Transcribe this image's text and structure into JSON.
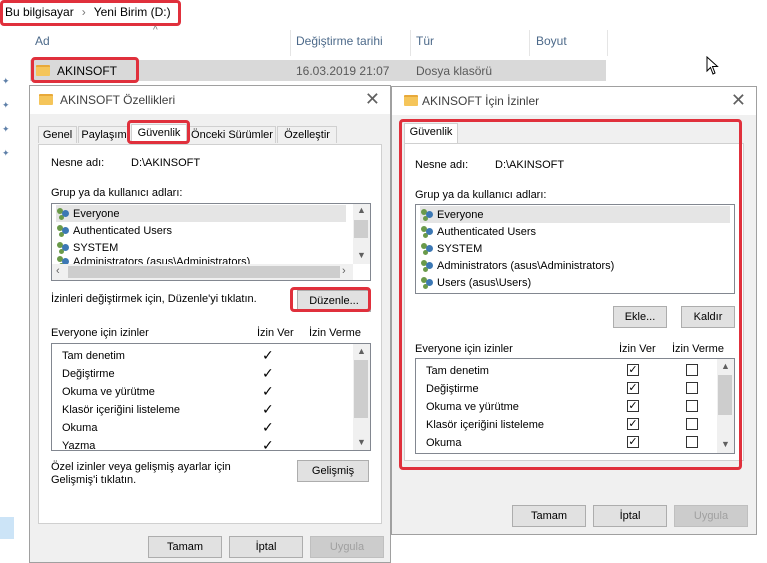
{
  "explorer": {
    "breadcrumb": [
      "Bu bilgisayar",
      "Yeni Birim (D:)"
    ],
    "breadcrumb_separator": "›",
    "columns": [
      "Ad",
      "Değiştirme tarihi",
      "Tür",
      "Boyut"
    ],
    "file": {
      "name": "AKINSOFT",
      "modified": "16.03.2019 21:07",
      "type": "Dosya klasörü"
    }
  },
  "props_dialog": {
    "title": "AKINSOFT Özellikleri",
    "tabs": [
      "Genel",
      "Paylaşım",
      "Güvenlik",
      "Önceki Sürümler",
      "Özelleştir"
    ],
    "active_tab": "Güvenlik",
    "object_label": "Nesne adı:",
    "object_value": "D:\\AKINSOFT",
    "group_label": "Grup ya da kullanıcı adları:",
    "users": [
      "Everyone",
      "Authenticated Users",
      "SYSTEM",
      "Administrators (asus\\Administrators)"
    ],
    "change_hint": "İzinleri değiştirmek için, Düzenle'yi tıklatın.",
    "edit_button": "Düzenle...",
    "perm_label": "Everyone için izinler",
    "allow_label": "İzin Ver",
    "deny_label": "İzin Verme",
    "permissions": [
      {
        "name": "Tam denetim",
        "allow": true,
        "deny": false
      },
      {
        "name": "Değiştirme",
        "allow": true,
        "deny": false
      },
      {
        "name": "Okuma ve yürütme",
        "allow": true,
        "deny": false
      },
      {
        "name": "Klasör içeriğini listeleme",
        "allow": true,
        "deny": false
      },
      {
        "name": "Okuma",
        "allow": true,
        "deny": false
      },
      {
        "name": "Yazma",
        "allow": true,
        "deny": false
      }
    ],
    "advanced_hint": "Özel izinler veya gelişmiş ayarlar için Gelişmiş'i tıklatın.",
    "advanced_button": "Gelişmiş",
    "ok": "Tamam",
    "cancel": "İptal",
    "apply": "Uygula"
  },
  "perm_dialog": {
    "title": "AKINSOFT İçin İzinler",
    "tab": "Güvenlik",
    "object_label": "Nesne adı:",
    "object_value": "D:\\AKINSOFT",
    "group_label": "Grup ya da kullanıcı adları:",
    "users": [
      "Everyone",
      "Authenticated Users",
      "SYSTEM",
      "Administrators (asus\\Administrators)",
      "Users (asus\\Users)"
    ],
    "add_button": "Ekle...",
    "remove_button": "Kaldır",
    "perm_label": "Everyone için izinler",
    "allow_label": "İzin Ver",
    "deny_label": "İzin Verme",
    "permissions": [
      {
        "name": "Tam denetim",
        "allow": true,
        "deny": false
      },
      {
        "name": "Değiştirme",
        "allow": true,
        "deny": false
      },
      {
        "name": "Okuma ve yürütme",
        "allow": true,
        "deny": false
      },
      {
        "name": "Klasör içeriğini listeleme",
        "allow": true,
        "deny": false
      },
      {
        "name": "Okuma",
        "allow": true,
        "deny": false
      }
    ],
    "ok": "Tamam",
    "cancel": "İptal",
    "apply": "Uygula"
  },
  "colors": {
    "highlight": "#e0303c",
    "folder": "#f5c55a",
    "selected_row": "#d9d9d9"
  }
}
